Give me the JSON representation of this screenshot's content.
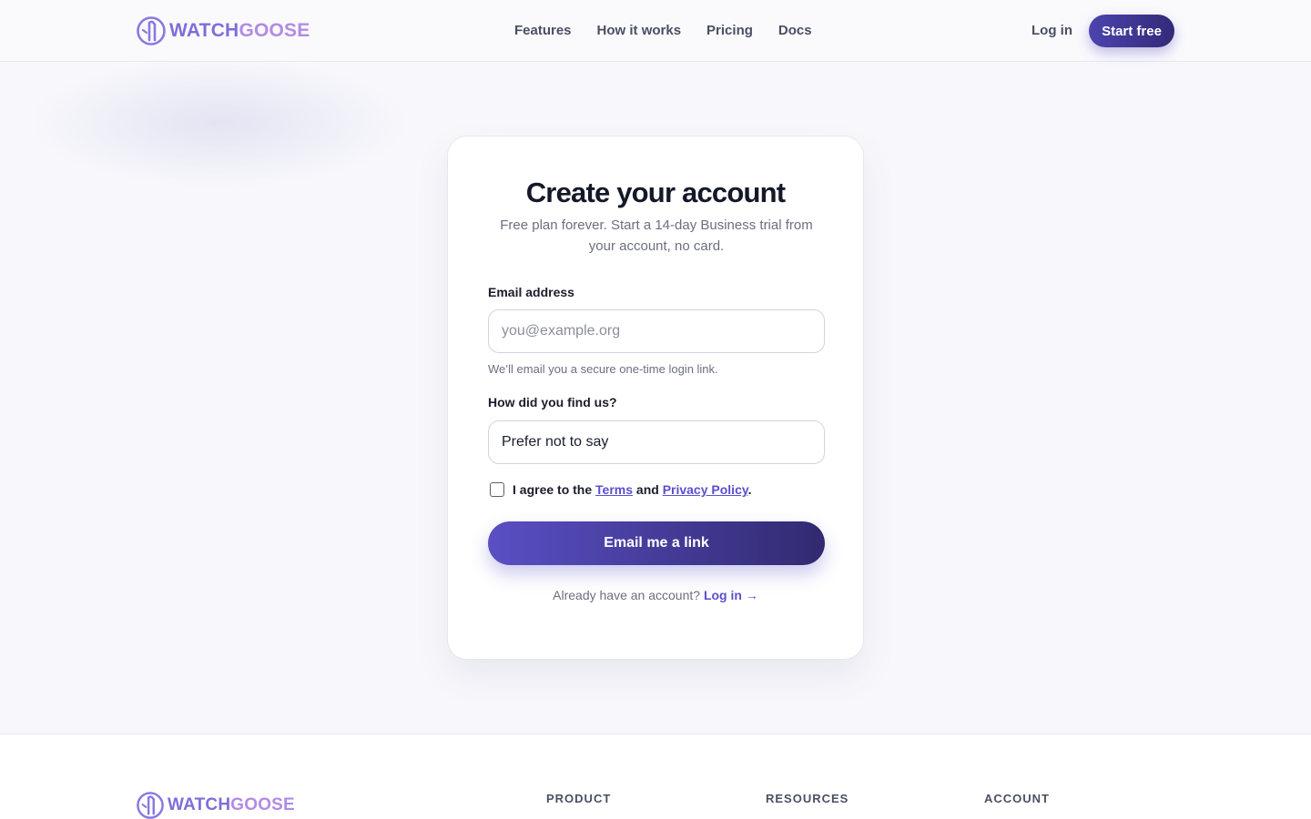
{
  "brand": {
    "name_part1": "WATCH",
    "name_part2": "GOOSE",
    "logo_icon": "goose-logo-icon"
  },
  "nav": {
    "items": [
      "Features",
      "How it works",
      "Pricing",
      "Docs"
    ],
    "login_label": "Log in",
    "start_label": "Start free"
  },
  "card": {
    "title": "Create your account",
    "subtitle": "Free plan forever. Start a 14-day Business trial from your account, no card.",
    "email_label": "Email address",
    "email_placeholder": "you@example.org",
    "email_value": "",
    "email_hint": "We’ll email you a secure one-time login link.",
    "source_label": "How did you find us?",
    "source_value": "Prefer not to say",
    "agree_prefix": "I agree to the ",
    "terms_link": "Terms",
    "agree_mid": " and ",
    "privacy_link": "Privacy Policy",
    "agree_suffix": ".",
    "agree_checked": false,
    "cta_label": "Email me a link",
    "already_text": "Already have an account?",
    "login_link": "Log in →"
  },
  "footer": {
    "columns": [
      "PRODUCT",
      "RESOURCES",
      "ACCOUNT"
    ]
  },
  "colors": {
    "accent": "#5b4fcf",
    "brand_dark": "#322a78",
    "logo_light": "#b28be6"
  }
}
